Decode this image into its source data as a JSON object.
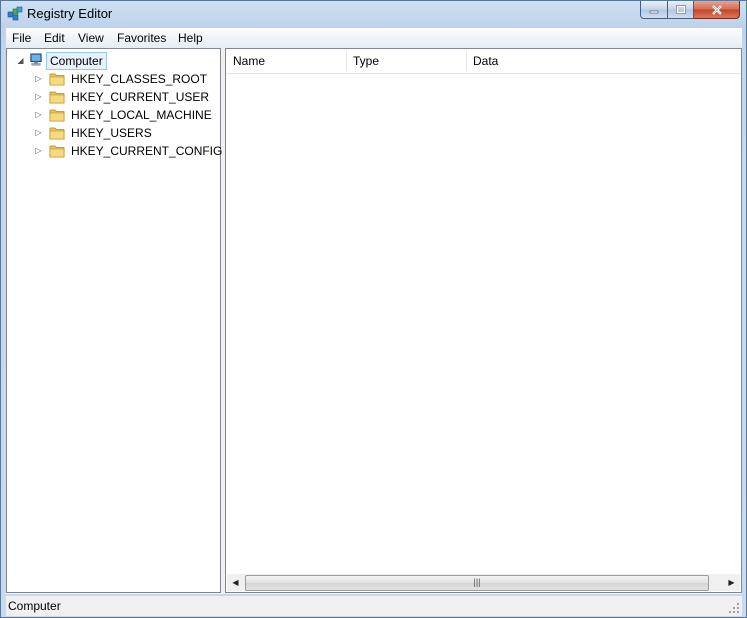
{
  "window": {
    "title": "Registry Editor",
    "icon": "registry-editor-icon",
    "caption_buttons": [
      "minimize-icon",
      "maximize-icon",
      "close-icon"
    ]
  },
  "menubar": {
    "items": [
      "File",
      "Edit",
      "View",
      "Favorites",
      "Help"
    ]
  },
  "tree": {
    "root": {
      "label": "Computer",
      "icon": "computer-icon",
      "expanded": true,
      "selected": true
    },
    "hives": [
      {
        "label": "HKEY_CLASSES_ROOT",
        "icon": "folder-icon"
      },
      {
        "label": "HKEY_CURRENT_USER",
        "icon": "folder-icon"
      },
      {
        "label": "HKEY_LOCAL_MACHINE",
        "icon": "folder-icon"
      },
      {
        "label": "HKEY_USERS",
        "icon": "folder-icon"
      },
      {
        "label": "HKEY_CURRENT_CONFIG",
        "icon": "folder-icon"
      }
    ]
  },
  "list": {
    "columns": [
      "Name",
      "Type",
      "Data"
    ],
    "rows": []
  },
  "statusbar": {
    "text": "Computer"
  },
  "colors": {
    "window_frame": "#bdd2ea",
    "selection_border": "#99c9ef",
    "close_button": "#c2452a",
    "folder": "#e8c45a"
  }
}
